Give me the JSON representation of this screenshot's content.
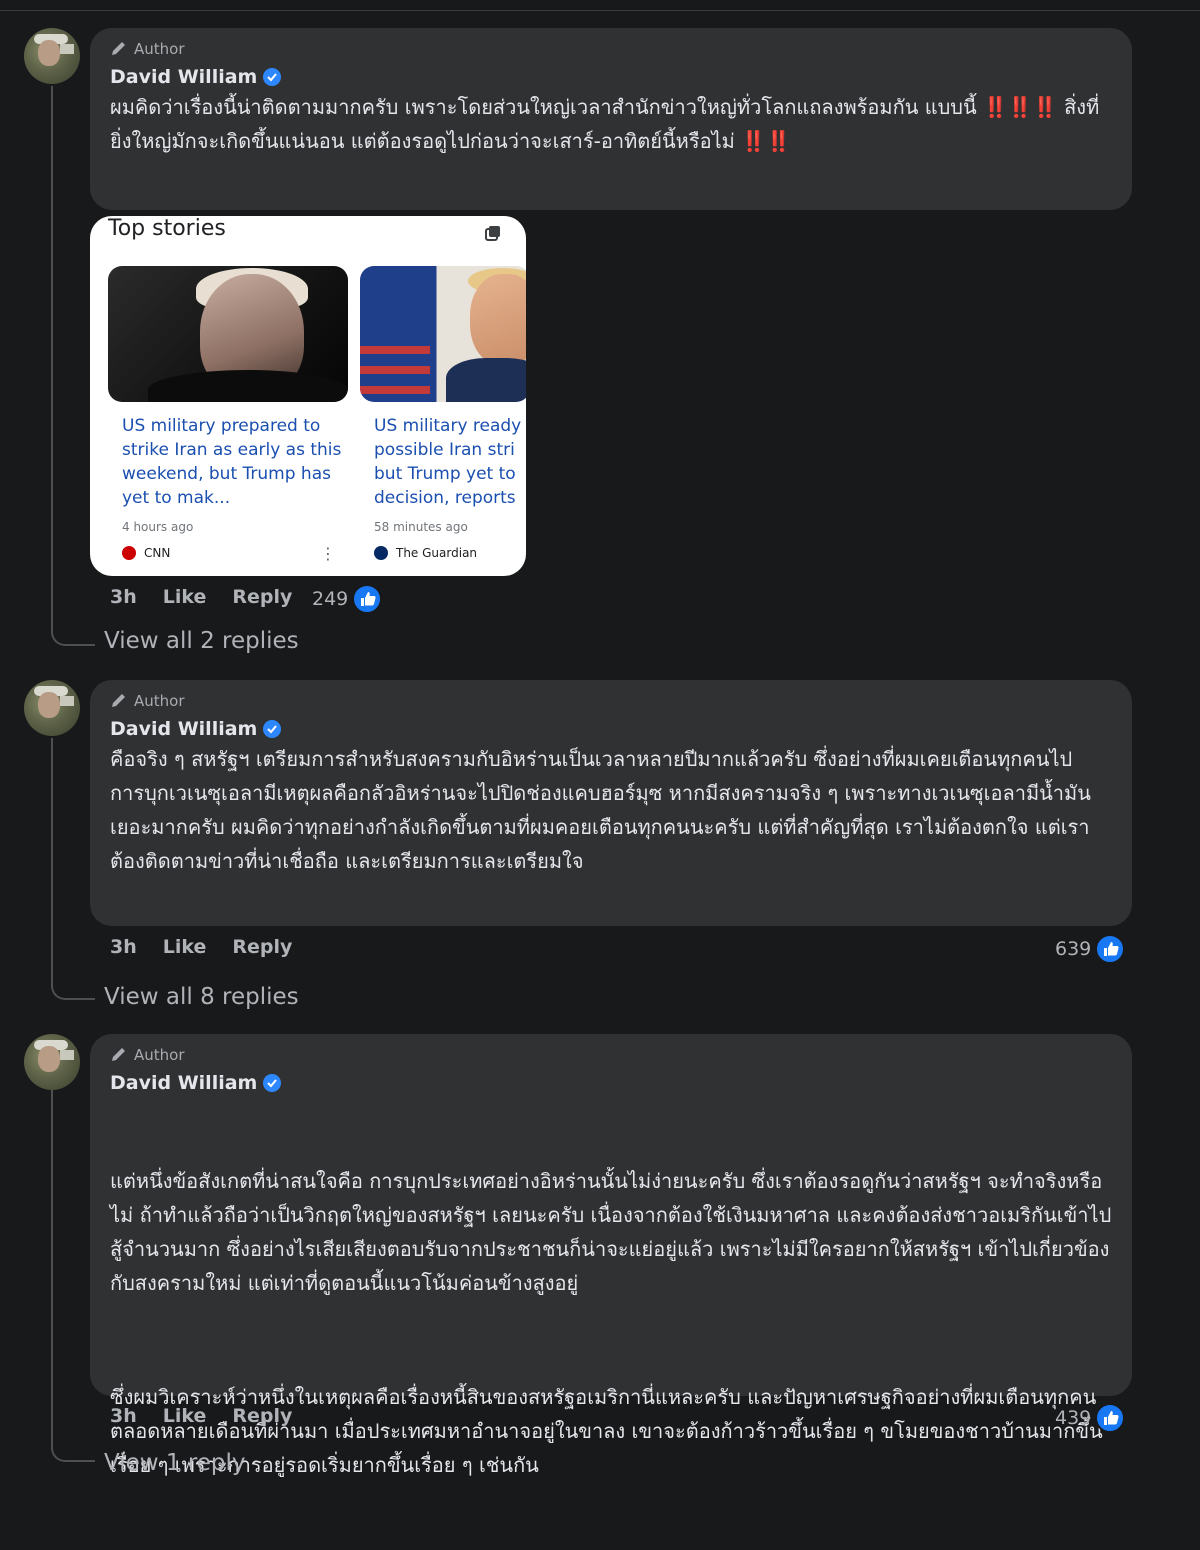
{
  "comments": [
    {
      "author_badge": "Author",
      "name": "David William",
      "text": "ผมคิดว่าเรื่องนี้น่าติดตามมากครับ เพราะโดยส่วนใหญ่เวลาสำนักข่าวใหญ่ทั่วโลกแถลงพร้อมกัน แบบนี้ ‼️‼️‼️ สิ่งที่ยิ่งใหญ่มักจะเกิดขึ้นแน่นอน แต่ต้องรอดูไปก่อนว่าจะเสาร์-อาทิตย์นี้หรือไม่ ‼️‼️",
      "time": "3h",
      "like": "Like",
      "reply": "Reply",
      "reactions": "249",
      "view_replies": "View all 2 replies"
    },
    {
      "author_badge": "Author",
      "name": "David William",
      "text": "คือจริง ๆ สหรัฐฯ เตรียมการสำหรับสงครามกับอิหร่านเป็นเวลาหลายปีมากแล้วครับ ซึ่งอย่างที่ผมเคยเตือนทุกคนไป การบุกเวเนซุเอลามีเหตุผลคือกลัวอิหร่านจะไปปิดช่องแคบฮอร์มุซ หากมีสงครามจริง ๆ เพราะทางเวเนซุเอลามีน้ำมันเยอะมากครับ ผมคิดว่าทุกอย่างกำลังเกิดขึ้นตามที่ผมคอยเตือนทุกคนนะครับ แต่ที่สำคัญที่สุด เราไม่ต้องตกใจ แต่เราต้องติดตามข่าวที่น่าเชื่อถือ และเตรียมการและเตรียมใจ",
      "time": "3h",
      "like": "Like",
      "reply": "Reply",
      "reactions": "639",
      "view_replies": "View all 8 replies"
    },
    {
      "author_badge": "Author",
      "name": "David William",
      "text": "แต่หนึ่งข้อสังเกตที่น่าสนใจคือ การบุกประเทศอย่างอิหร่านนั้นไม่ง่ายนะครับ ซึ่งเราต้องรอดูกันว่าสหรัฐฯ จะทำจริงหรือไม่ ถ้าทำแล้วถือว่าเป็นวิกฤตใหญ่ของสหรัฐฯ เลยนะครับ เนื่องจากต้องใช้เงินมหาศาล และคงต้องส่งชาวอเมริกันเข้าไปสู้จำนวนมาก ซึ่งอย่างไรเสียเสียงตอบรับจากประชาชนก็น่าจะแย่อยู่แล้ว เพราะไม่มีใครอยากให้สหรัฐฯ เข้าไปเกี่ยวข้องกับสงครามใหม่ แต่เท่าที่ดูตอนนี้แนวโน้มค่อนข้างสูงอยู่",
      "text2": "ซึ่งผมวิเคราะห์ว่าหนึ่งในเหตุผลคือเรื่องหนี้สินของสหรัฐอเมริกานี่แหละครับ และปัญหาเศรษฐกิจอย่างที่ผมเตือนทุกคนตลอดหลายเดือนที่ผ่านมา เมื่อประเทศมหาอำนาจอยู่ในขาลง เขาจะต้องก้าวร้าวขึ้นเรื่อย ๆ ขโมยของชาวบ้านมากขึ้นเรื่อย ๆ เพราะการอยู่รอดเริ่มยากขึ้นเรื่อย ๆ เช่นกัน",
      "time": "3h",
      "like": "Like",
      "reply": "Reply",
      "reactions": "439",
      "view_replies": "View 1 reply"
    }
  ],
  "top_stories": {
    "title": "Top stories",
    "items": [
      {
        "headline": "US military prepared to strike Iran as early as this weekend, but Trump has yet to mak...",
        "time": "4 hours ago",
        "source": "CNN",
        "source_color": "#cc0000"
      },
      {
        "headline": "US military ready possible Iran stri but Trump yet to decision, reports",
        "time": "58 minutes ago",
        "source": "The Guardian",
        "source_color": "#052962"
      }
    ]
  },
  "colors": {
    "background": "#18191a",
    "bubble": "#303133",
    "verified": "#2d88ff",
    "like": "#1877f2"
  }
}
